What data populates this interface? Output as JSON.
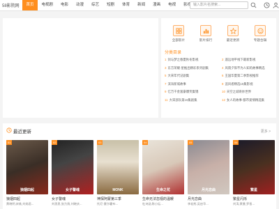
{
  "site": {
    "logo": "58影院网"
  },
  "nav": {
    "items": [
      "首页",
      "电视剧",
      "电影",
      "动漫",
      "综艺",
      "短剧",
      "体育",
      "新闻",
      "漫画",
      "电视",
      "影视"
    ],
    "active_index": 0,
    "more": "更多 ▾",
    "search_placeholder": "输入影片名搜索..."
  },
  "quick_links": [
    {
      "label": "全部影片",
      "icon": "grid-icon"
    },
    {
      "label": "影片排行",
      "icon": "chart-icon"
    },
    {
      "label": "最近更新",
      "icon": "star-icon"
    },
    {
      "label": "专题合辑",
      "icon": "smile-icon"
    }
  ],
  "categories": {
    "title": "分类目录",
    "items": [
      {
        "n": "1",
        "text": "剑与梦之春夏秋冬影视"
      },
      {
        "n": "2",
        "text": "遥远地平线下最新影视"
      },
      {
        "n": "3",
        "text": "东方荣耀·星推出精彩系列剧集"
      },
      {
        "n": "4",
        "text": "风雨夕阳不为人知的故事精选"
      },
      {
        "n": "5",
        "text": "大宋年代记剧集"
      },
      {
        "n": "6",
        "text": "王国华夏第二季影视推荐"
      },
      {
        "n": "7",
        "text": "滨海新城故事"
      },
      {
        "n": "8",
        "text": "追风者精选15集影视"
      },
      {
        "n": "9",
        "text": "亿万千金富豪爆笑集锦"
      },
      {
        "n": "10",
        "text": "天空之城奇妙世界"
      },
      {
        "n": "11",
        "text": "大宋部队第16集剧集"
      },
      {
        "n": "12",
        "text": "女人的故事·都市爱情精选集"
      }
    ]
  },
  "recent": {
    "title": "最近更新",
    "more": "更多 >",
    "items": [
      {
        "badge": "01",
        "title": "狼烟四起",
        "desc": "黄晓明,宋轶,刘奕君..."
      },
      {
        "badge": "02",
        "title": "女子警魂",
        "desc": "刘思思,张力扬,刘晓庆..."
      },
      {
        "badge": "03",
        "title": "神探阿蒙第三季",
        "desc": "托尼·夏尔霍布..."
      },
      {
        "badge": "04",
        "title": "生命无法忽视的温暖",
        "desc": "杜诗涵,陈小纭..."
      },
      {
        "badge": "05",
        "title": "月光恋曲",
        "desc": "李若彤,吴启华..."
      },
      {
        "badge": "06",
        "title": "繁星闪烁",
        "desc": "刘涛,黄曼,罗晋..."
      }
    ],
    "poster_texts": [
      "狼烟四起",
      "女子警魂",
      "MONK",
      "生命之花",
      "月光恋曲",
      "繁星"
    ]
  },
  "colors": {
    "accent": "#ff8f1f"
  }
}
